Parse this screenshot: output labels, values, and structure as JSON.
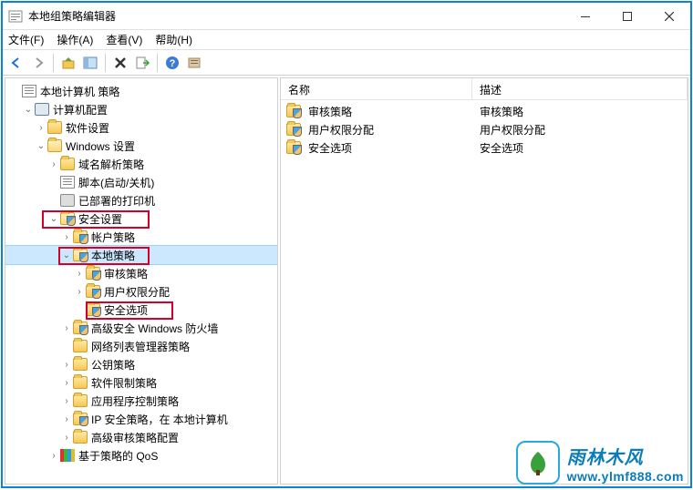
{
  "window": {
    "title": "本地组策略编辑器"
  },
  "menu": {
    "file": "文件(F)",
    "action": "操作(A)",
    "view": "查看(V)",
    "help": "帮助(H)"
  },
  "tree": {
    "root": "本地计算机 策略",
    "computer_config": "计算机配置",
    "software_settings": "软件设置",
    "windows_settings": "Windows 设置",
    "name_resolution": "域名解析策略",
    "scripts": "脚本(启动/关机)",
    "deployed_printers": "已部署的打印机",
    "security_settings": "安全设置",
    "account_policies": "帐户策略",
    "local_policies": "本地策略",
    "audit_policy": "审核策略",
    "user_rights": "用户权限分配",
    "security_options": "安全选项",
    "windows_firewall": "高级安全 Windows 防火墙",
    "network_list": "网络列表管理器策略",
    "public_key": "公钥策略",
    "software_restriction": "软件限制策略",
    "app_control": "应用程序控制策略",
    "ip_security": "IP 安全策略，在 本地计算机",
    "advanced_audit": "高级审核策略配置",
    "qos": "基于策略的 QoS"
  },
  "list": {
    "header_name": "名称",
    "header_desc": "描述",
    "rows": [
      {
        "name": "审核策略",
        "desc": "审核策略"
      },
      {
        "name": "用户权限分配",
        "desc": "用户权限分配"
      },
      {
        "name": "安全选项",
        "desc": "安全选项"
      }
    ]
  },
  "watermark": {
    "cn": "雨林木风",
    "url": "www.ylmf888.com"
  }
}
